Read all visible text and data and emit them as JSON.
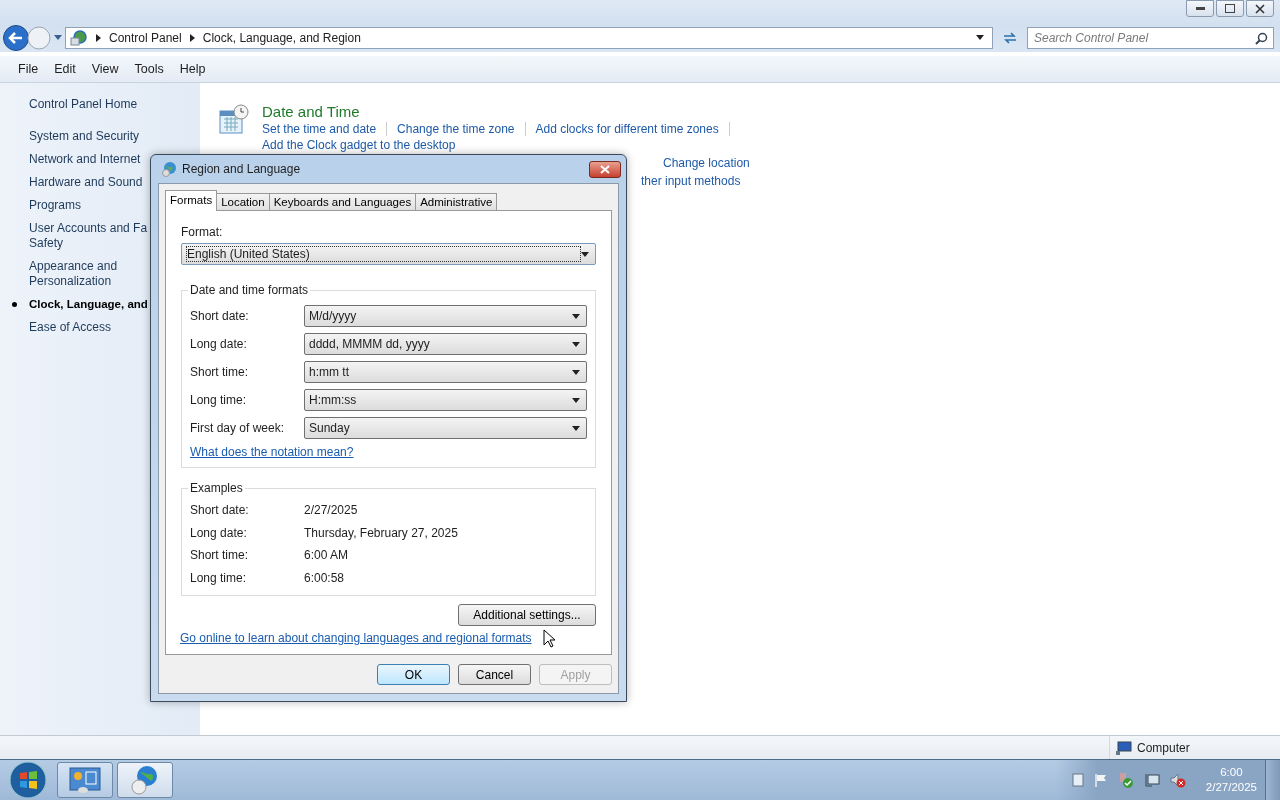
{
  "address_bar": {
    "crumbs": [
      "Control Panel",
      "Clock, Language, and Region"
    ],
    "search_placeholder": "Search Control Panel"
  },
  "menu": [
    "File",
    "Edit",
    "View",
    "Tools",
    "Help"
  ],
  "sidebar": {
    "home": "Control Panel Home",
    "items": [
      {
        "label": "System and Security",
        "selected": false
      },
      {
        "label": "Network and Internet",
        "selected": false
      },
      {
        "label": "Hardware and Sound",
        "selected": false
      },
      {
        "label": "Programs",
        "selected": false
      },
      {
        "label": "User Accounts and Fa\nSafety",
        "selected": false
      },
      {
        "label": "Appearance and\nPersonalization",
        "selected": false
      },
      {
        "label": "Clock, Language, and",
        "selected": true
      },
      {
        "label": "Ease of Access",
        "selected": false
      }
    ]
  },
  "sections": [
    {
      "title": "Date and Time",
      "links": [
        "Set the time and date",
        "Change the time zone",
        "Add clocks for different time zones",
        "Add the Clock gadget to the desktop"
      ]
    },
    {
      "links": [
        "Change location",
        "ther input methods"
      ]
    }
  ],
  "dialog": {
    "title": "Region and Language",
    "tabs": [
      {
        "label": "Formats",
        "selected": true
      },
      {
        "label": "Location",
        "selected": false
      },
      {
        "label": "Keyboards and Languages",
        "selected": false
      },
      {
        "label": "Administrative",
        "selected": false
      }
    ],
    "format_label": "Format:",
    "format_value": "English (United States)",
    "formats_group": "Date and time formats",
    "formats": [
      {
        "label": "Short date:",
        "value": "M/d/yyyy"
      },
      {
        "label": "Long date:",
        "value": "dddd, MMMM dd, yyyy"
      },
      {
        "label": "Short time:",
        "value": "h:mm tt"
      },
      {
        "label": "Long time:",
        "value": "H:mm:ss"
      },
      {
        "label": "First day of week:",
        "value": "Sunday"
      }
    ],
    "notation_link": "What does the notation mean?",
    "examples_group": "Examples",
    "examples": [
      {
        "label": "Short date:",
        "value": "2/27/2025"
      },
      {
        "label": "Long date:",
        "value": "Thursday, February 27, 2025"
      },
      {
        "label": "Short time:",
        "value": "6:00 AM"
      },
      {
        "label": "Long time:",
        "value": "6:00:58"
      }
    ],
    "additional_button": "Additional settings...",
    "online_link": "Go online to learn about changing languages and regional formats",
    "buttons": [
      {
        "label": "OK",
        "disabled": false
      },
      {
        "label": "Cancel",
        "disabled": false
      },
      {
        "label": "Apply",
        "disabled": true
      }
    ]
  },
  "status_bar": {
    "location": "Computer"
  },
  "taskbar": {
    "time": "6:00",
    "date": "2/27/2025"
  }
}
